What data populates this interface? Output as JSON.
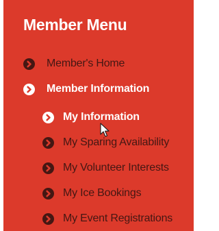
{
  "menu": {
    "title": "Member Menu",
    "items": [
      {
        "label": "Member's Home",
        "icon": "chevron-right-circle-icon",
        "level": 1,
        "state": "normal"
      },
      {
        "label": "Member Information",
        "icon": "chevron-right-circle-icon",
        "level": 1,
        "state": "active"
      },
      {
        "label": "My Information",
        "icon": "chevron-right-circle-icon",
        "level": 2,
        "state": "hover"
      },
      {
        "label": "My Sparing Availability",
        "icon": "chevron-right-circle-icon",
        "level": 2,
        "state": "normal"
      },
      {
        "label": "My Volunteer Interests",
        "icon": "chevron-right-circle-icon",
        "level": 2,
        "state": "normal"
      },
      {
        "label": "My Ice Bookings",
        "icon": "chevron-right-circle-icon",
        "level": 2,
        "state": "normal"
      },
      {
        "label": "My Event Registrations",
        "icon": "chevron-right-circle-icon",
        "level": 2,
        "state": "normal"
      }
    ]
  },
  "colors": {
    "panel_background": "#dc3a2b",
    "text_default": "#451713",
    "text_active": "#ffffff"
  }
}
